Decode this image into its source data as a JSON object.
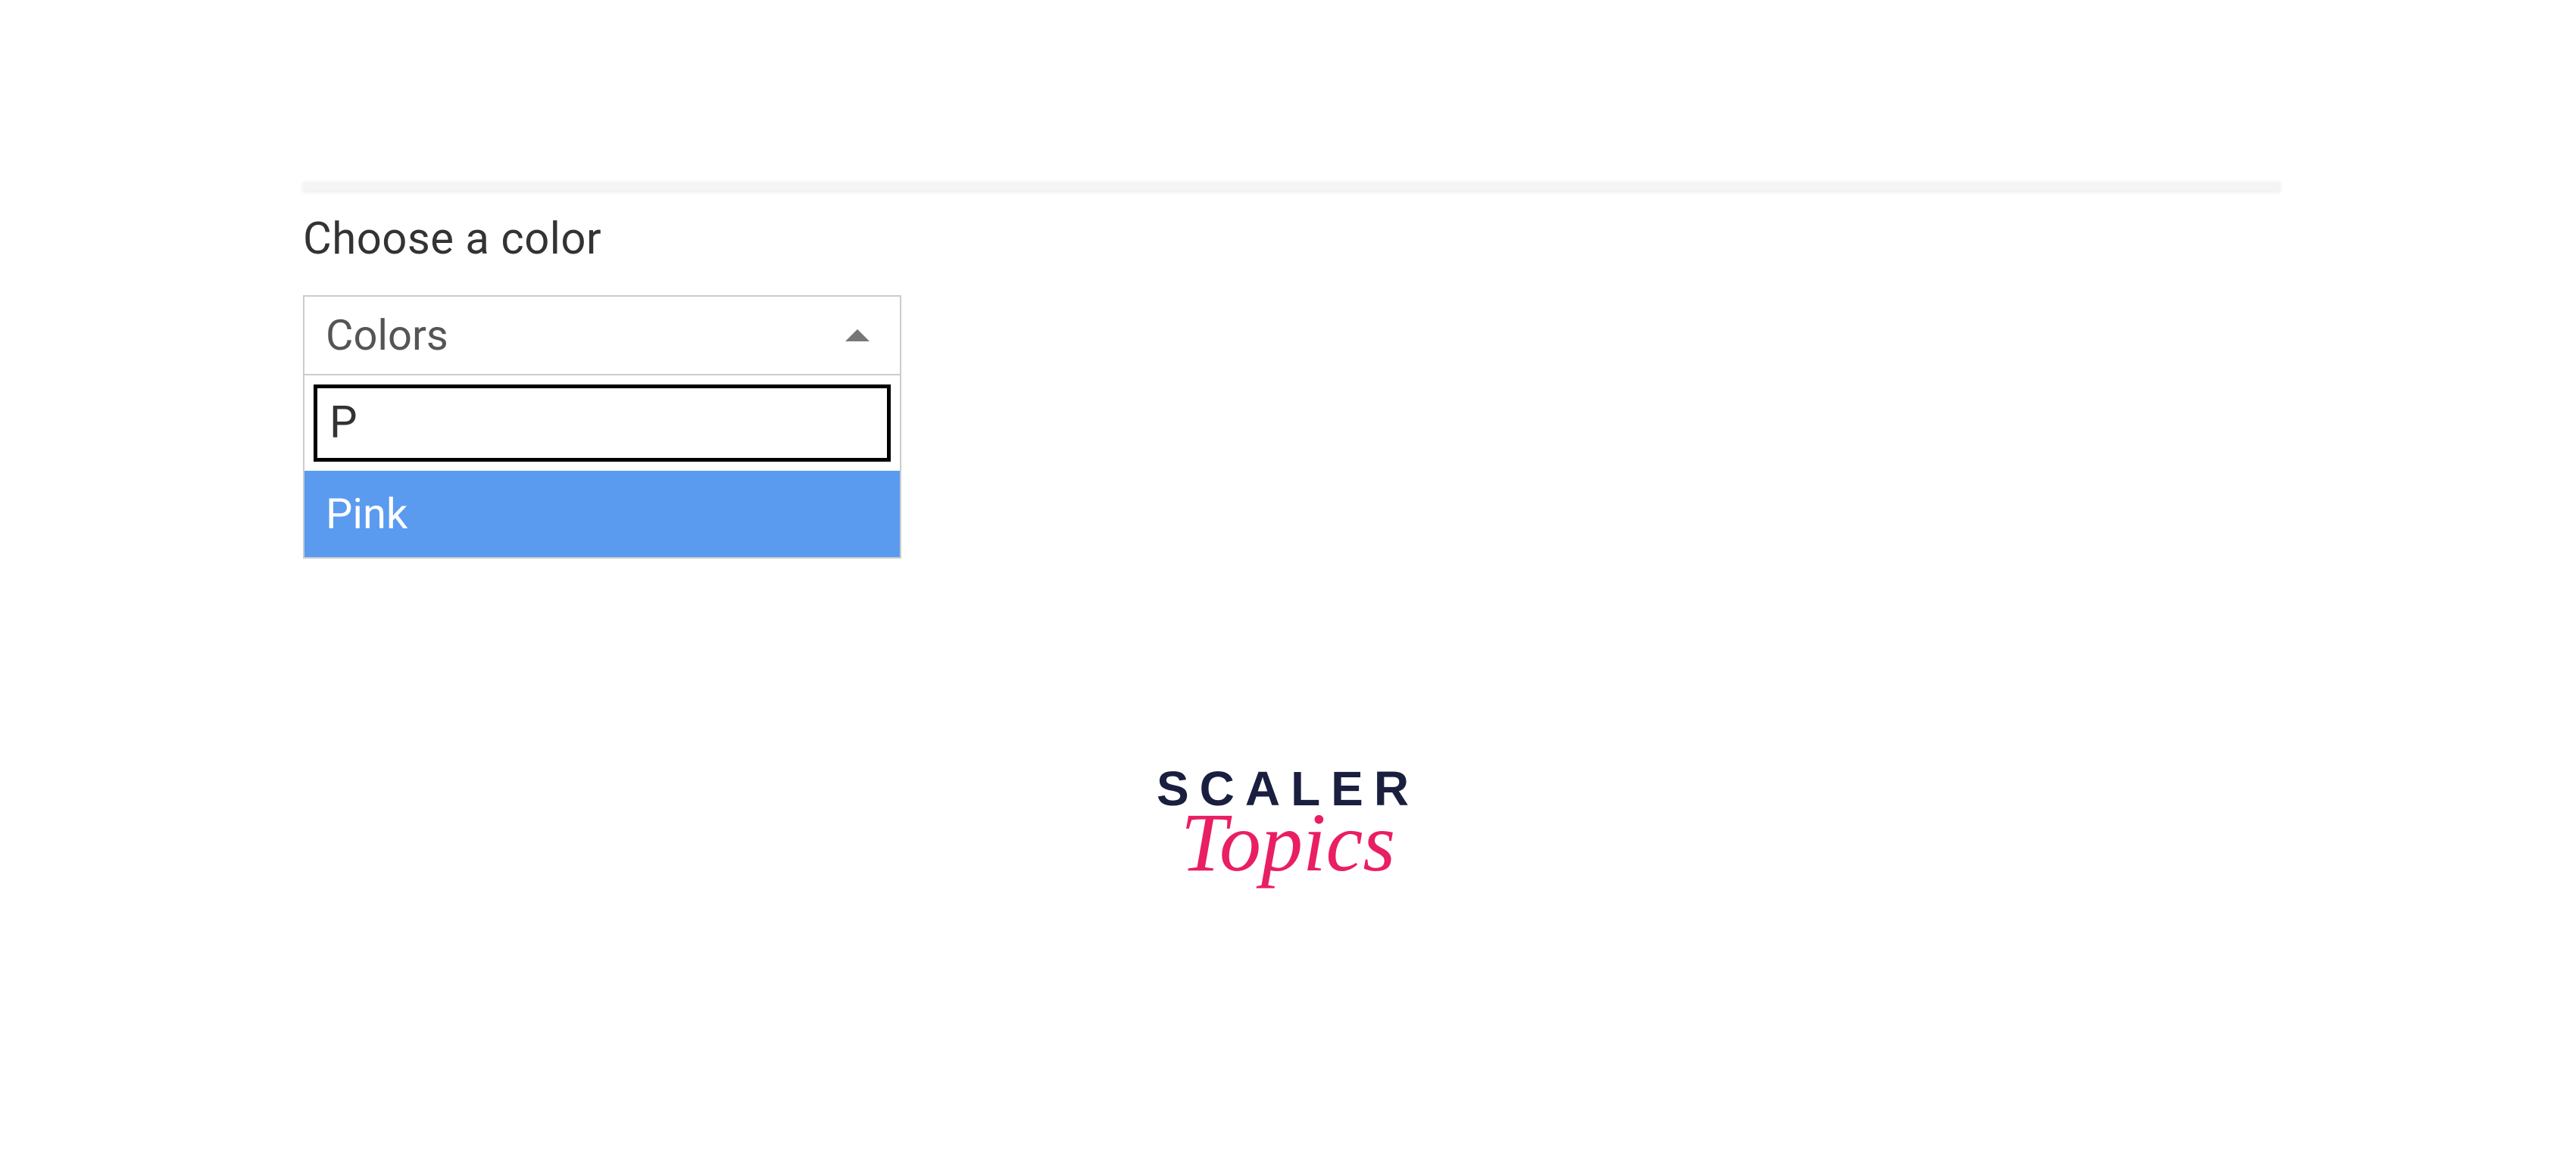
{
  "form": {
    "label": "Choose a color",
    "select": {
      "placeholder_label": "Colors",
      "search_value": "P",
      "options": [
        {
          "label": "Pink",
          "highlighted": true
        }
      ]
    }
  },
  "logo": {
    "line1": "SCALER",
    "line2": "Topics"
  }
}
